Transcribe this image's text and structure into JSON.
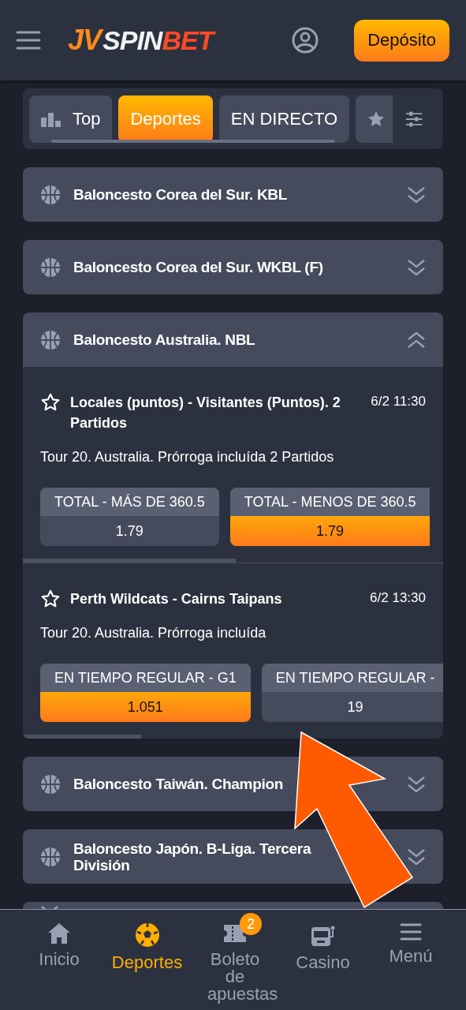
{
  "header": {
    "logo": {
      "mark": "JV",
      "word": "SPIN",
      "accent": "BET"
    },
    "deposit_button": "Depósito"
  },
  "tabs": [
    {
      "kind": "top",
      "label": "Top",
      "selected": false
    },
    {
      "kind": "plain",
      "label": "Deportes",
      "selected": true
    },
    {
      "kind": "plain",
      "label": "EN DIRECTO",
      "selected": false
    },
    {
      "kind": "favorites",
      "selected": false
    }
  ],
  "leagues": [
    {
      "name": "Baloncesto Corea del Sur. KBL",
      "expanded": false
    },
    {
      "name": "Baloncesto Corea del Sur. WKBL (F)",
      "expanded": false
    },
    {
      "name": "Baloncesto Australia. NBL",
      "expanded": true,
      "events": [
        {
          "title": "Locales (puntos) - Visitantes (Puntos). 2 Partidos",
          "time": "6/2 11:30",
          "description": "Tour 20. Australia. Prórroga incluída 2 Partidos",
          "odds": [
            {
              "label": "TOTAL - MÁS DE 360.5",
              "value": "1.79",
              "selected": false
            },
            {
              "label": "TOTAL - MENOS DE 360.5",
              "value": "1.79",
              "selected": true
            }
          ]
        },
        {
          "title": "Perth Wildcats - Cairns Taipans",
          "time": "6/2 13:30",
          "description": "Tour 20. Australia. Prórroga incluída",
          "odds": [
            {
              "label": "EN TIEMPO REGULAR - G1",
              "value": "1.051",
              "selected": true
            },
            {
              "label": "EN TIEMPO REGULAR -",
              "value": "19",
              "selected": false
            }
          ]
        }
      ]
    },
    {
      "name": "Baloncesto Taiwán. Champion",
      "expanded": false
    },
    {
      "name": "Baloncesto Japón. B-Liga. Tercera División",
      "expanded": false
    },
    {
      "expanded": false
    }
  ],
  "bottom_nav": [
    {
      "kind": "home",
      "label": "Inicio",
      "selected": false
    },
    {
      "kind": "sports",
      "label": "Deportes",
      "selected": true
    },
    {
      "kind": "ticket",
      "label": "Boleto de apuestas",
      "selected": false,
      "badge": "2"
    },
    {
      "kind": "casino",
      "label": "Casino",
      "selected": false
    },
    {
      "kind": "menu",
      "label": "Menú",
      "selected": false
    }
  ],
  "annotation": {
    "kind": "arrow"
  }
}
